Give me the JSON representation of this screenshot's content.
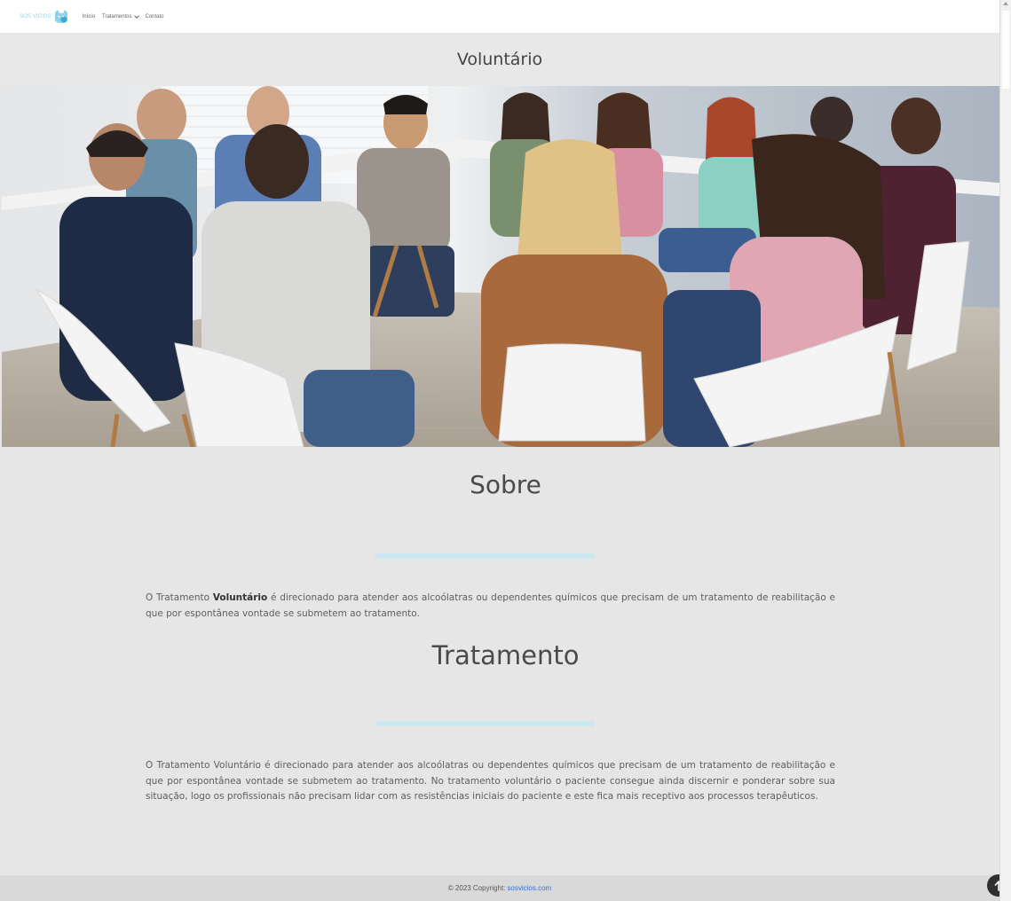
{
  "nav": {
    "logo_text": "SOS VICIOS",
    "items": [
      {
        "label": "Início"
      },
      {
        "label": "Tratamentos"
      },
      {
        "label": "Contato"
      }
    ]
  },
  "page_title": "Voluntário",
  "sections": {
    "about": {
      "heading": "Sobre",
      "text_before": "O Tratamento ",
      "text_bold": "Voluntário",
      "text_after": " é direcionado para atender aos alcoólatras ou dependentes químicos que precisam de um tratamento de reabilitação e que por espontânea vontade se submetem ao tratamento."
    },
    "treatment": {
      "heading": "Tratamento",
      "text": "O Tratamento Voluntário é direcionado para atender aos alcoólatras ou dependentes químicos que precisam de um tratamento de reabilitação e que por espontânea vontade se submetem ao tratamento. No tratamento voluntário o paciente consegue ainda discernir e ponderar sobre sua situação, logo os profissionais não precisam lidar com as resistências iniciais do paciente e este fica mais receptivo aos processos terapêuticos."
    }
  },
  "footer": {
    "copyright": "© 2023 Copyright:",
    "link_text": "sosvicios.com"
  },
  "colors": {
    "accent": "#c9e8f0",
    "link": "#3b6fd4",
    "background": "#e6e6e6"
  },
  "icons": {
    "logo": "cat-logo-icon",
    "dropdown": "chevron-down-icon",
    "back_to_top": "arrow-up-icon"
  }
}
